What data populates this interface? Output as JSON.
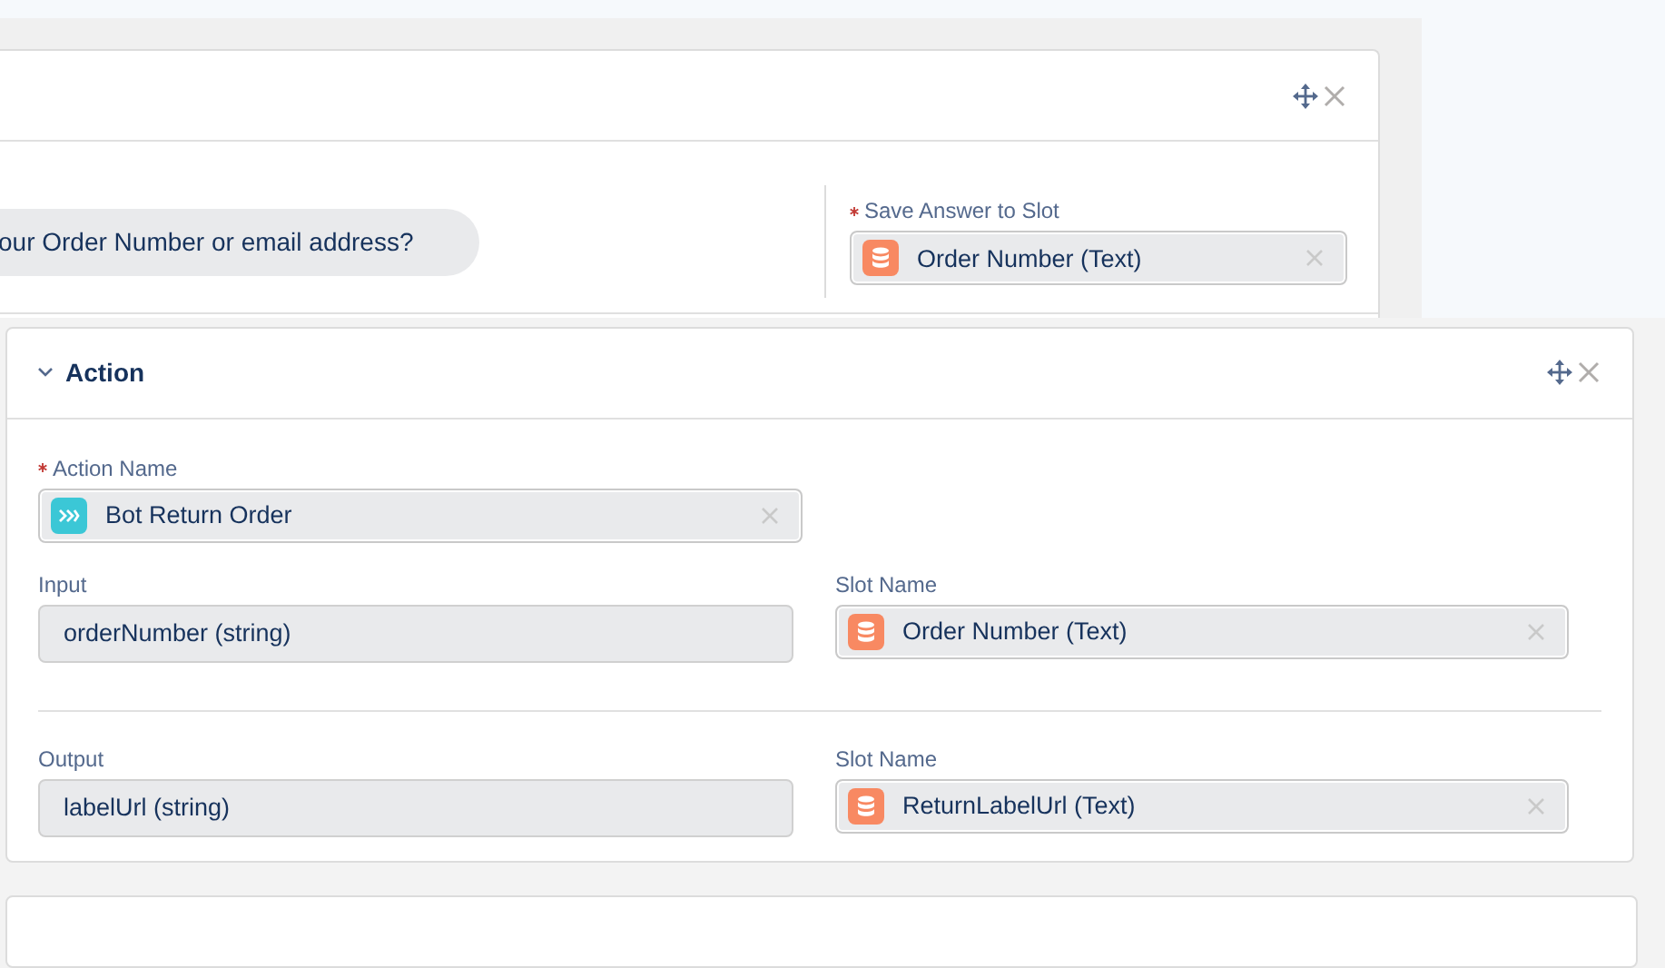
{
  "question_card": {
    "question": "our Order Number or email address?",
    "save_slot": {
      "label": "Save Answer to Slot",
      "required": true,
      "value": "Order Number (Text)"
    }
  },
  "action_card": {
    "title": "Action",
    "expanded": true,
    "action_name": {
      "label": "Action Name",
      "required": true,
      "value": "Bot Return Order"
    },
    "mappings": [
      {
        "param_label": "Input",
        "param_value": "orderNumber (string)",
        "slot_label": "Slot Name",
        "slot_value": "Order Number (Text)"
      },
      {
        "param_label": "Output",
        "param_value": "labelUrl (string)",
        "slot_label": "Slot Name",
        "slot_value": "ReturnLabelUrl (Text)"
      }
    ]
  }
}
